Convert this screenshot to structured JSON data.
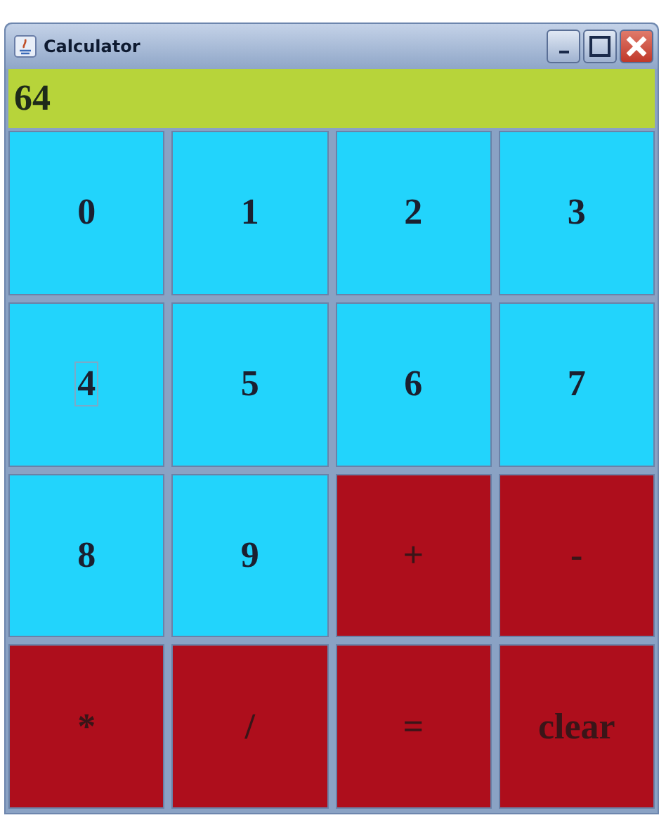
{
  "window": {
    "title": "Calculator"
  },
  "display": {
    "value": "64"
  },
  "keys": [
    {
      "label": "0",
      "kind": "digit",
      "focused": false
    },
    {
      "label": "1",
      "kind": "digit",
      "focused": false
    },
    {
      "label": "2",
      "kind": "digit",
      "focused": false
    },
    {
      "label": "3",
      "kind": "digit",
      "focused": false
    },
    {
      "label": "4",
      "kind": "digit",
      "focused": true
    },
    {
      "label": "5",
      "kind": "digit",
      "focused": false
    },
    {
      "label": "6",
      "kind": "digit",
      "focused": false
    },
    {
      "label": "7",
      "kind": "digit",
      "focused": false
    },
    {
      "label": "8",
      "kind": "digit",
      "focused": false
    },
    {
      "label": "9",
      "kind": "digit",
      "focused": false
    },
    {
      "label": "+",
      "kind": "operator",
      "focused": false
    },
    {
      "label": "-",
      "kind": "operator",
      "focused": false
    },
    {
      "label": "*",
      "kind": "operator",
      "focused": false
    },
    {
      "label": "/",
      "kind": "operator",
      "focused": false
    },
    {
      "label": "=",
      "kind": "operator",
      "focused": false
    },
    {
      "label": "clear",
      "kind": "operator",
      "focused": false
    }
  ]
}
